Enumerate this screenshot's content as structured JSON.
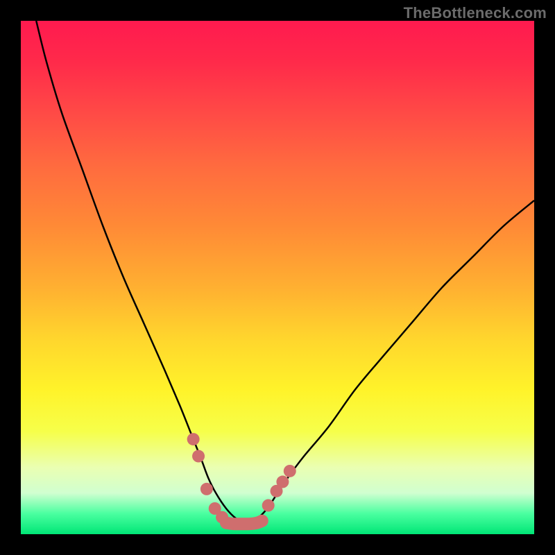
{
  "watermark": "TheBottleneck.com",
  "chart_data": {
    "type": "line",
    "title": "",
    "xlabel": "",
    "ylabel": "",
    "xlim": [
      0,
      100
    ],
    "ylim": [
      0,
      100
    ],
    "grid": false,
    "legend": false,
    "series": [
      {
        "name": "left-curve",
        "x": [
          3,
          5,
          8,
          12,
          16,
          20,
          24,
          28,
          31,
          33,
          35,
          36.5,
          38,
          40,
          42,
          44
        ],
        "y": [
          100,
          92,
          82,
          71,
          60,
          50,
          41,
          32,
          25,
          20,
          15,
          11,
          8,
          5,
          3,
          2
        ]
      },
      {
        "name": "right-curve",
        "x": [
          44,
          46,
          48,
          50,
          52,
          55,
          60,
          65,
          70,
          76,
          82,
          88,
          94,
          100
        ],
        "y": [
          2,
          3,
          5,
          8,
          11,
          15,
          21,
          28,
          34,
          41,
          48,
          54,
          60,
          65
        ]
      },
      {
        "name": "markers-left",
        "x": [
          33.6,
          34.6,
          36.2,
          37.8,
          39.2
        ],
        "y": [
          18.5,
          15.2,
          8.8,
          5.0,
          3.3
        ]
      },
      {
        "name": "markers-right",
        "x": [
          48.2,
          49.8,
          51.0,
          52.4
        ],
        "y": [
          5.6,
          8.4,
          10.2,
          12.3
        ]
      },
      {
        "name": "bottom-bar",
        "x": [
          40,
          41.5,
          43,
          44.5,
          46,
          47
        ],
        "y": [
          2.2,
          2.0,
          2.0,
          2.0,
          2.2,
          2.6
        ]
      }
    ],
    "annotations": [
      {
        "text": "TheBottleneck.com",
        "position": "top-right"
      }
    ]
  },
  "colors": {
    "curve_stroke": "#000000",
    "marker_fill": "#cf6e6e",
    "marker_stroke": "#cf6e6e",
    "background_black": "#000000"
  }
}
